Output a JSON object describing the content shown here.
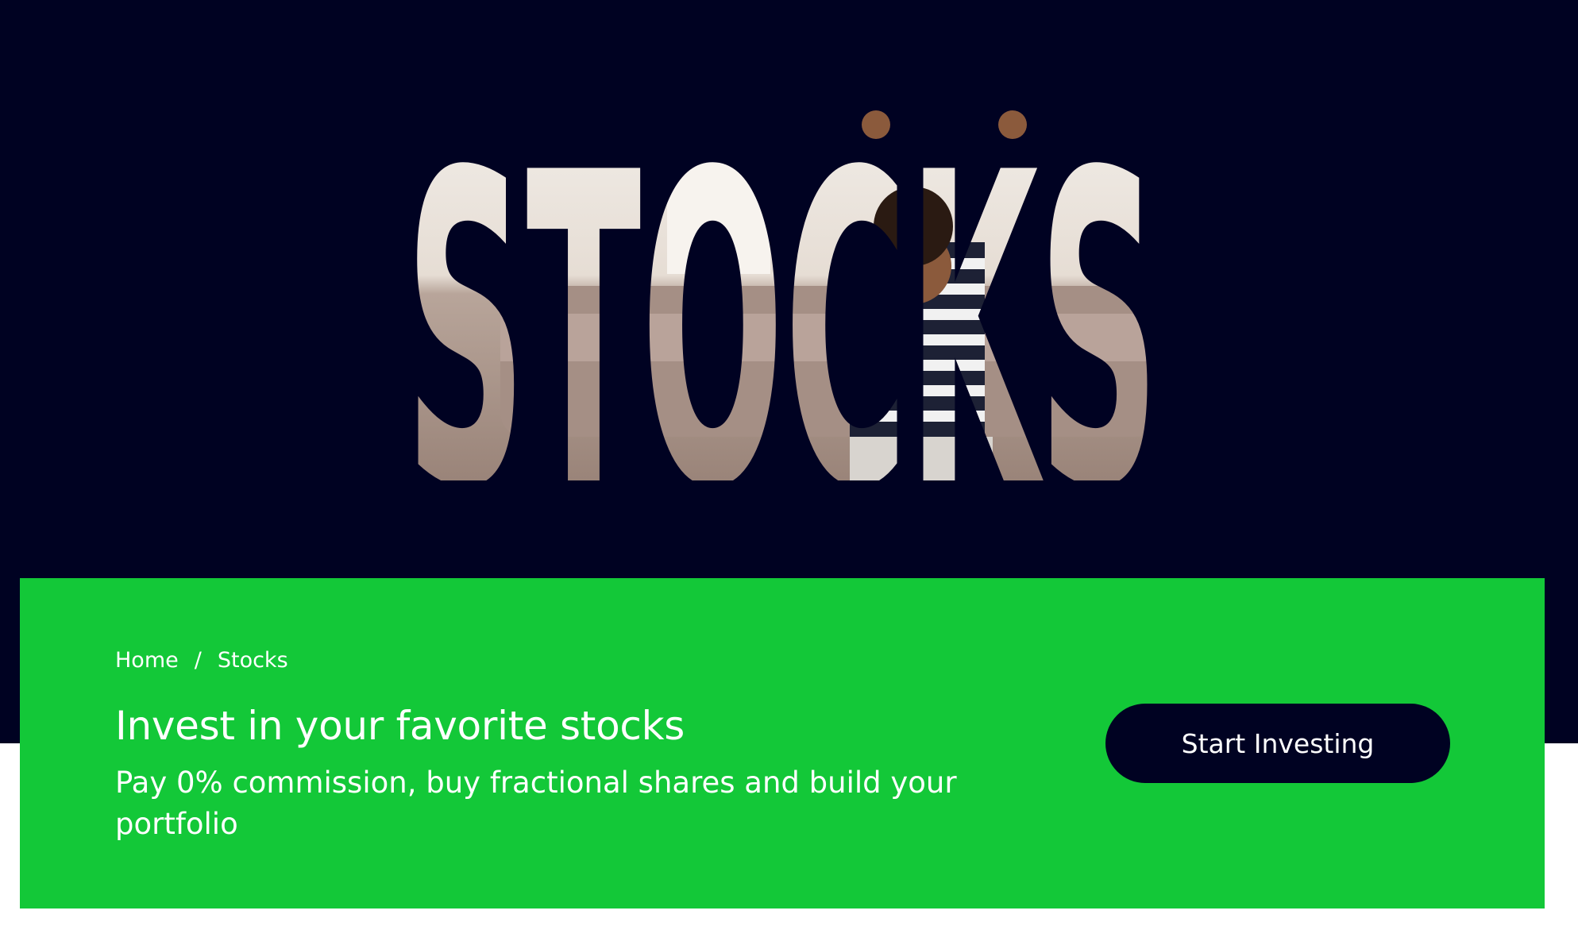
{
  "hero": {
    "word": "STOCKS",
    "image_description_icon": "person-celebrating-image"
  },
  "breadcrumb": {
    "home": "Home",
    "separator": "/",
    "current": "Stocks"
  },
  "headline": "Invest in your favorite stocks",
  "subheadline": "Pay 0% commission, buy fractional shares and build your portfolio",
  "cta": {
    "label": "Start Investing"
  },
  "colors": {
    "navy": "#000222",
    "green": "#13c838",
    "white": "#ffffff"
  }
}
